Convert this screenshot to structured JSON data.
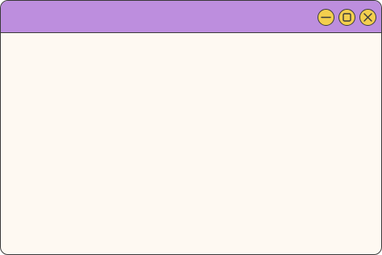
{
  "window": {
    "title": "",
    "colors": {
      "titlebar": "#bd8ede",
      "body": "#fef9f2",
      "border": "#3a3a3a",
      "control": "#f3cf4e"
    },
    "controls": [
      {
        "icon": "minimize-icon"
      },
      {
        "icon": "maximize-icon"
      },
      {
        "icon": "close-icon"
      }
    ]
  }
}
